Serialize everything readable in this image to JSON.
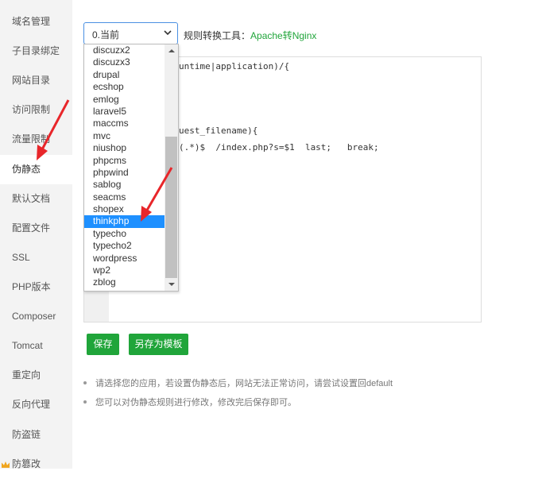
{
  "sidebar": {
    "items": [
      {
        "label": "域名管理"
      },
      {
        "label": "子目录绑定"
      },
      {
        "label": "网站目录"
      },
      {
        "label": "访问限制"
      },
      {
        "label": "流量限制"
      },
      {
        "label": "伪静态"
      },
      {
        "label": "默认文档"
      },
      {
        "label": "配置文件"
      },
      {
        "label": "SSL"
      },
      {
        "label": "PHP版本"
      },
      {
        "label": "Composer"
      },
      {
        "label": "Tomcat"
      },
      {
        "label": "重定向"
      },
      {
        "label": "反向代理"
      },
      {
        "label": "防盗链"
      },
      {
        "label": "防篡改"
      }
    ]
  },
  "select": {
    "value": "0.当前"
  },
  "rule_tool": {
    "label": "规则转换工具：",
    "link": "Apache转Nginx"
  },
  "dropdown": {
    "options": [
      "discuzx2",
      "discuzx3",
      "drupal",
      "ecshop",
      "emlog",
      "laravel5",
      "maccms",
      "mvc",
      "niushop",
      "phpcms",
      "phpwind",
      "sablog",
      "seacms",
      "shopex",
      "thinkphp",
      "typecho",
      "typecho2",
      "wordpress",
      "wp2",
      "zblog"
    ],
    "selected": "thinkphp"
  },
  "editor": {
    "line1": "untime|application)/{",
    "line2": "uest_filename){",
    "line3": "(.*)$  /index.php?s=$1  last;   break;"
  },
  "buttons": {
    "save": "保存",
    "save_template": "另存为模板"
  },
  "tips": [
    "请选择您的应用，若设置伪静态后，网站无法正常访问，请尝试设置回default",
    "您可以对伪静态规则进行修改，修改完后保存即可。"
  ],
  "colors": {
    "accent": "#20a53a",
    "selected": "#1e90ff",
    "annotation": "#e8262a"
  }
}
